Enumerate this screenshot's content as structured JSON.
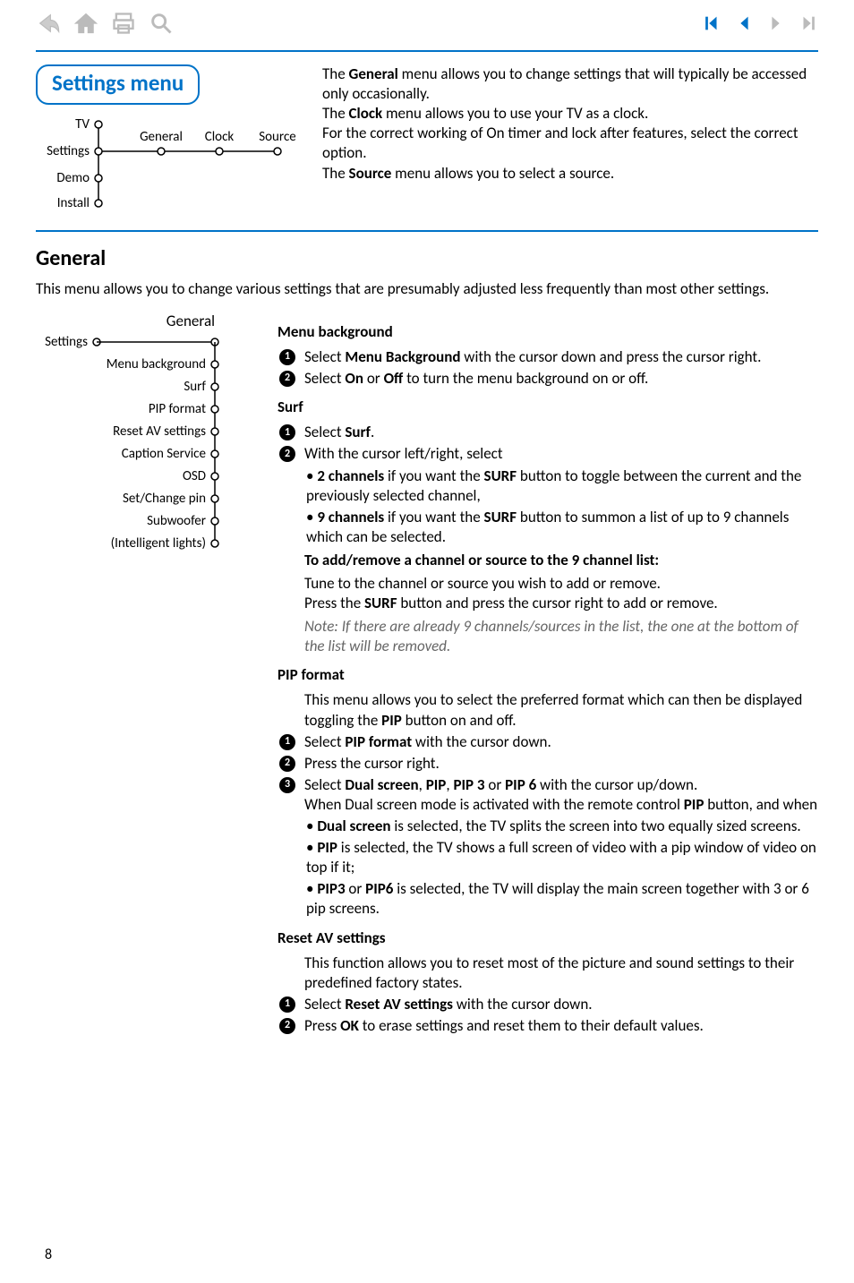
{
  "page_number": "8",
  "box_title": "Settings menu",
  "top_diagram": {
    "left_labels": [
      "TV",
      "Settings",
      "Demo",
      "Install"
    ],
    "top_labels": [
      "General",
      "Clock",
      "Source"
    ]
  },
  "intro": {
    "p1_a": "The ",
    "p1_b": "General",
    "p1_c": " menu allows you to change settings that will typically be accessed only occasionally.",
    "p2_a": "The ",
    "p2_b": "Clock",
    "p2_c": " menu allows you to use your TV as a clock.",
    "p3": "For the correct working of On timer and lock after features, select the correct option.",
    "p4_a": "The ",
    "p4_b": "Source",
    "p4_c": " menu allows you to select a source."
  },
  "section_title": "General",
  "section_intro": "This menu allows you to change various settings that are presumably adjusted less frequently than most other settings.",
  "general_diagram": {
    "title": "General",
    "root": "Settings",
    "items": [
      "Menu background",
      "Surf",
      "PIP format",
      "Reset AV settings",
      "Caption Service",
      "OSD",
      "Set/Change pin",
      "Subwoofer",
      "(Intelligent lights)"
    ]
  },
  "menu_bg": {
    "heading": "Menu background",
    "s1_a": "Select ",
    "s1_b": "Menu Background",
    "s1_c": " with the cursor down and press the cursor right.",
    "s2_a": "Select ",
    "s2_b": "On",
    "s2_c": " or ",
    "s2_d": "Off",
    "s2_e": " to turn the menu background on or off."
  },
  "surf": {
    "heading": "Surf",
    "s1_a": "Select ",
    "s1_b": "Surf",
    "s1_c": ".",
    "s2": "With the cursor left/right, select",
    "b1_a": "2 channels",
    "b1_b": " if you want the ",
    "b1_c": "SURF",
    "b1_d": " button to toggle between the current and the previously selected channel,",
    "b2_a": "9 channels",
    "b2_b": " if you want the ",
    "b2_c": "SURF",
    "b2_d": " button to summon a list of up to 9 channels which can be selected.",
    "addremove_title": "To add/remove a channel or source to the 9 channel list:",
    "addremove_p1": "Tune to the channel or source you wish to add or remove.",
    "addremove_p2_a": "Press the ",
    "addremove_p2_b": "SURF",
    "addremove_p2_c": " button and press the cursor right to add or remove.",
    "addremove_note": "Note: If there are already 9 channels/sources in the list, the one at the bottom of the list will be removed."
  },
  "pip": {
    "heading": "PIP format",
    "intro_a": "This menu allows you to select the preferred format which can then be displayed toggling the ",
    "intro_b": "PIP",
    "intro_c": " button on and off.",
    "s1_a": "Select ",
    "s1_b": "PIP format",
    "s1_c": " with the cursor down.",
    "s2": "Press the cursor right.",
    "s3_a": "Select ",
    "s3_b": "Dual screen",
    "s3_c": ", ",
    "s3_d": "PIP",
    "s3_e": ", ",
    "s3_f": "PIP 3",
    "s3_g": " or ",
    "s3_h": "PIP 6",
    "s3_i": " with the cursor up/down.",
    "s3_after_a": "When Dual screen mode is activated with the remote control ",
    "s3_after_b": "PIP",
    "s3_after_c": " button, and when",
    "b1_a": "Dual screen",
    "b1_b": " is selected, the TV splits the screen into two equally sized screens.",
    "b2_a": "PIP",
    "b2_b": " is selected, the TV shows a full screen of video with a pip window of video on top if it;",
    "b3_a": "PIP3",
    "b3_b": " or ",
    "b3_c": "PIP6",
    "b3_d": " is selected, the TV will display the main screen together with 3 or 6 pip screens."
  },
  "reset": {
    "heading": "Reset AV settings",
    "intro": "This function allows you to reset most of the picture and sound settings to their predefined factory states.",
    "s1_a": "Select ",
    "s1_b": "Reset AV settings",
    "s1_c": " with the cursor down.",
    "s2_a": "Press ",
    "s2_b": "OK",
    "s2_c": " to erase settings and reset them to their default values."
  }
}
